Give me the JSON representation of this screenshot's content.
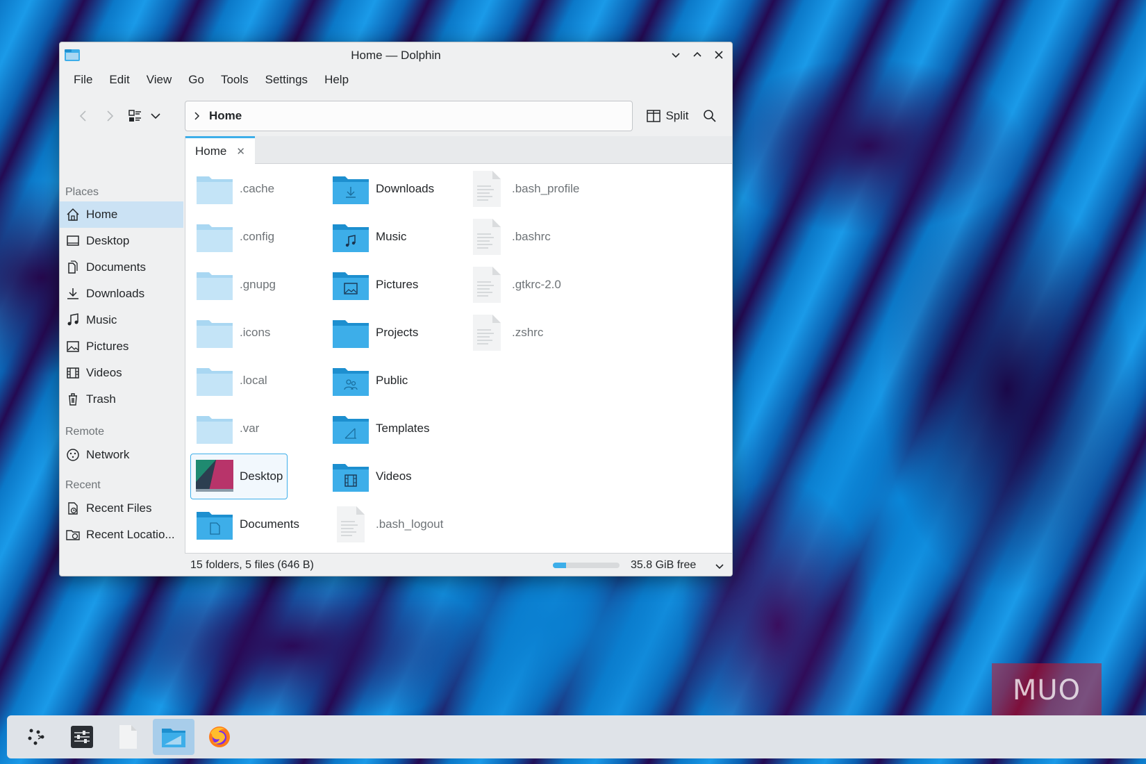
{
  "window": {
    "title": "Home — Dolphin"
  },
  "menu": [
    "File",
    "Edit",
    "View",
    "Go",
    "Tools",
    "Settings",
    "Help"
  ],
  "toolbar": {
    "location": "Home",
    "split_label": "Split"
  },
  "sidebar": {
    "places_label": "Places",
    "places": [
      {
        "label": "Home",
        "icon": "home-icon",
        "active": true
      },
      {
        "label": "Desktop",
        "icon": "desktop-icon"
      },
      {
        "label": "Documents",
        "icon": "documents-icon"
      },
      {
        "label": "Downloads",
        "icon": "downloads-icon"
      },
      {
        "label": "Music",
        "icon": "music-icon"
      },
      {
        "label": "Pictures",
        "icon": "pictures-icon"
      },
      {
        "label": "Videos",
        "icon": "videos-icon"
      },
      {
        "label": "Trash",
        "icon": "trash-icon"
      }
    ],
    "remote_label": "Remote",
    "remote": [
      {
        "label": "Network",
        "icon": "network-icon"
      }
    ],
    "recent_label": "Recent",
    "recent": [
      {
        "label": "Recent Files",
        "icon": "recent-files-icon"
      },
      {
        "label": "Recent Locatio...",
        "icon": "recent-locations-icon"
      }
    ]
  },
  "tab": {
    "label": "Home"
  },
  "files": [
    {
      "name": ".cache",
      "kind": "hidden-folder"
    },
    {
      "name": ".config",
      "kind": "hidden-folder"
    },
    {
      "name": ".gnupg",
      "kind": "hidden-folder"
    },
    {
      "name": ".icons",
      "kind": "hidden-folder"
    },
    {
      "name": ".local",
      "kind": "hidden-folder"
    },
    {
      "name": ".var",
      "kind": "hidden-folder"
    },
    {
      "name": "Desktop",
      "kind": "desktop-folder",
      "selected": true
    },
    {
      "name": "Documents",
      "kind": "documents-folder"
    },
    {
      "name": "Downloads",
      "kind": "downloads-folder"
    },
    {
      "name": "Music",
      "kind": "music-folder"
    },
    {
      "name": "Pictures",
      "kind": "pictures-folder"
    },
    {
      "name": "Projects",
      "kind": "folder"
    },
    {
      "name": "Public",
      "kind": "public-folder"
    },
    {
      "name": "Templates",
      "kind": "templates-folder"
    },
    {
      "name": "Videos",
      "kind": "videos-folder"
    },
    {
      "name": ".bash_logout",
      "kind": "hidden-file"
    },
    {
      "name": ".bash_profile",
      "kind": "hidden-file"
    },
    {
      "name": ".bashrc",
      "kind": "hidden-file"
    },
    {
      "name": ".gtkrc-2.0",
      "kind": "hidden-file"
    },
    {
      "name": ".zshrc",
      "kind": "hidden-file"
    }
  ],
  "status": {
    "summary": "15 folders, 5 files (646 B)",
    "free_space": "35.8 GiB free",
    "used_fraction": 0.2
  },
  "taskbar": {
    "items": [
      {
        "name": "app-launcher",
        "icon": "launcher-icon"
      },
      {
        "name": "system-settings",
        "icon": "settings-icon"
      },
      {
        "name": "text-editor",
        "icon": "document-icon"
      },
      {
        "name": "dolphin",
        "icon": "dolphin-icon",
        "active": true
      },
      {
        "name": "firefox",
        "icon": "firefox-icon"
      }
    ]
  },
  "watermark": "MUO",
  "colors": {
    "accent": "#3daee9",
    "folder": "#3daee9",
    "folder_hidden": "#a9d7f2",
    "window_bg": "#eff0f1",
    "selection": "#cbe2f4"
  }
}
